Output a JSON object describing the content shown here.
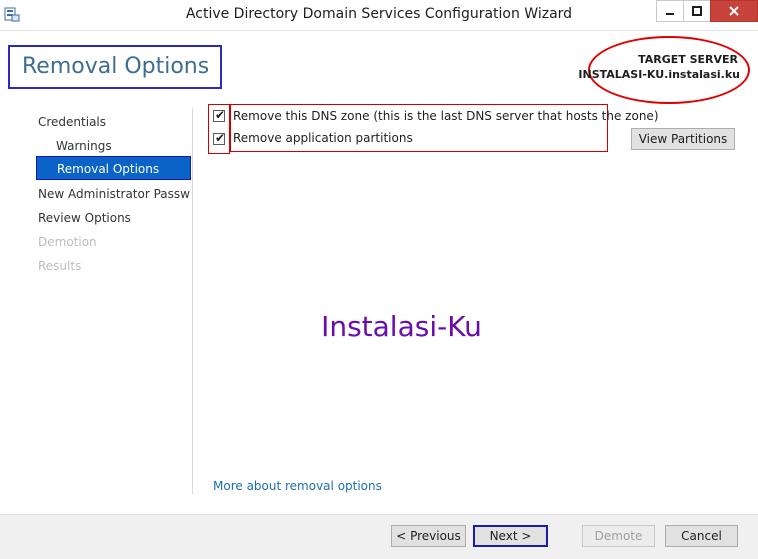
{
  "window": {
    "title": "Active Directory Domain Services Configuration Wizard",
    "icon": "server-manager-icon"
  },
  "header": {
    "page_title": "Removal Options",
    "target_label": "TARGET SERVER",
    "target_name": "INSTALASI-KU.instalasi.ku"
  },
  "nav": {
    "items": [
      {
        "label": "Credentials",
        "state": "normal"
      },
      {
        "label": "Warnings",
        "state": "normal"
      },
      {
        "label": "Removal Options",
        "state": "selected"
      },
      {
        "label": "New Administrator Passw...",
        "state": "normal"
      },
      {
        "label": "Review Options",
        "state": "normal"
      },
      {
        "label": "Demotion",
        "state": "disabled"
      },
      {
        "label": "Results",
        "state": "disabled"
      }
    ]
  },
  "options": {
    "dns_zone": {
      "label": "Remove this DNS zone (this is the last DNS server that hosts the zone)",
      "checked": true
    },
    "app_partitions": {
      "label": "Remove application partitions",
      "checked": true
    },
    "view_partitions_label": "View Partitions"
  },
  "watermark": "Instalasi-Ku",
  "more_link": "More about removal options",
  "footer": {
    "previous": "< Previous",
    "next": "Next >",
    "demote": "Demote",
    "cancel": "Cancel"
  },
  "colors": {
    "accent": "#0a64c8",
    "annotation_red": "#e00000",
    "annotation_blue": "#2a2ac0",
    "watermark": "#6a0dad",
    "link": "#1e6fb0"
  }
}
